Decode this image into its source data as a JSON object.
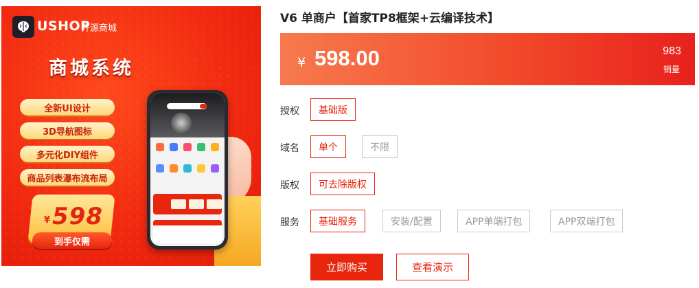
{
  "banner": {
    "logo_text": "USHOP",
    "logo_sub": "开源商城",
    "title": "商城系统",
    "features": [
      "全新UI设计",
      "3D导航图标",
      "多元化DIY组件",
      "商品列表瀑布流布局"
    ],
    "badge_currency": "¥",
    "badge_price": "598",
    "badge_cta": "到手仅需"
  },
  "product": {
    "title": "V6 单商户【首家TP8框架+云编译技术】",
    "currency": "¥",
    "price": "598.00",
    "sales_count": "983",
    "sales_label": "销量"
  },
  "options": {
    "license": {
      "label": "授权",
      "items": [
        "基础版"
      ],
      "selected": "基础版"
    },
    "domain": {
      "label": "域名",
      "items": [
        "单个",
        "不限"
      ],
      "selected": "单个"
    },
    "copyright": {
      "label": "版权",
      "items": [
        "可去除版权"
      ],
      "selected": "可去除版权"
    },
    "service": {
      "label": "服务",
      "items": [
        "基础服务",
        "安装/配置",
        "APP单端打包",
        "APP双端打包"
      ],
      "selected": "基础服务"
    }
  },
  "actions": {
    "buy_label": "立即购买",
    "demo_label": "查看演示"
  },
  "colors": {
    "accent": "#e8250d",
    "price_gradient_start": "#f77a4e",
    "price_gradient_end": "#e8211c"
  }
}
